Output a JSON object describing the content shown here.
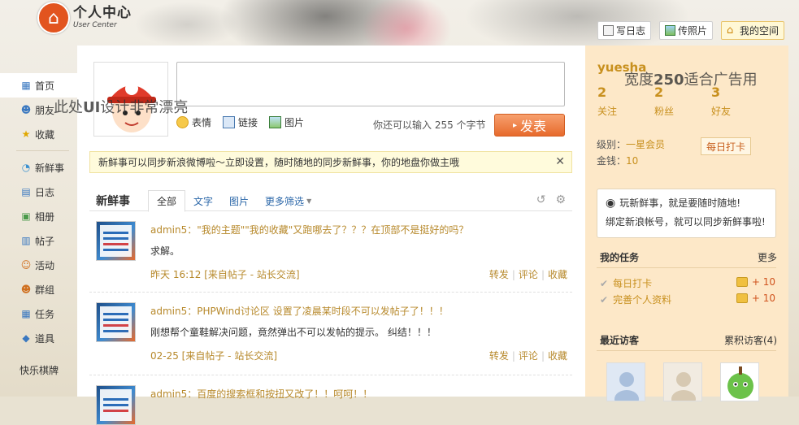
{
  "logo": {
    "title": "个人中心",
    "subtitle": "User Center"
  },
  "topbar": {
    "write_log": "写日志",
    "upload_photo": "传照片",
    "my_space": "我的空间"
  },
  "sidebar": {
    "items": [
      {
        "label": "首页",
        "icon": "home-icon"
      },
      {
        "label": "朋友",
        "icon": "friends-icon"
      },
      {
        "label": "收藏",
        "icon": "star-icon"
      },
      {
        "label": "新鲜事",
        "icon": "chat-icon"
      },
      {
        "label": "日志",
        "icon": "log-icon"
      },
      {
        "label": "相册",
        "icon": "album-icon"
      },
      {
        "label": "帖子",
        "icon": "post-icon"
      },
      {
        "label": "活动",
        "icon": "event-icon"
      },
      {
        "label": "群组",
        "icon": "group-icon"
      },
      {
        "label": "任务",
        "icon": "task-icon"
      },
      {
        "label": "道具",
        "icon": "tool-icon"
      }
    ],
    "game": "快乐棋牌"
  },
  "compose": {
    "emoji": "表情",
    "link": "链接",
    "image": "图片",
    "counter": "你还可以输入 255 个字节",
    "submit": "发表"
  },
  "notice": "新鲜事可以同步新浪微博啦～立即设置，随时随地的同步新鲜事，你的地盘你做主哦",
  "feed": {
    "title": "新鲜事",
    "tabs": [
      "全部",
      "文字",
      "图片",
      "更多筛选"
    ],
    "posts": [
      {
        "title": "admin5：\"我的主题\"\"我的收藏\"又跑哪去了？？？在顶部不是挺好的吗？",
        "body": "求解。",
        "meta": "昨天 16:12 [来自帖子 - 站长交流]"
      },
      {
        "title": "admin5：PHPWind讨论区 设置了凌晨某时段不可以发帖子了！！！",
        "body": "刚想帮个童鞋解决问题，竟然弹出不可以发帖的提示。 纠结！！！",
        "meta": "02-25 [来自帖子 - 站长交流]"
      },
      {
        "title": "admin5：百度的搜索框和按扭又改了！！呵呵！！",
        "body": "",
        "meta": ""
      }
    ],
    "actions": {
      "share": "转发",
      "comment": "评论",
      "fav": "收藏"
    }
  },
  "profile": {
    "username": "yuesha",
    "stats": [
      {
        "num": "2",
        "label": "关注"
      },
      {
        "num": "2",
        "label": "粉丝"
      },
      {
        "num": "3",
        "label": "好友"
      }
    ],
    "level_label": "级别：",
    "level": "一星会员",
    "money_label": "金钱：",
    "money": "10",
    "checkin": "每日打卡"
  },
  "sina": {
    "title": "玩新鲜事，就是要随时随地!",
    "desc": "绑定新浪帐号，就可以同步新鲜事啦!"
  },
  "tasks": {
    "title": "我的任务",
    "more": "更多",
    "items": [
      {
        "label": "每日打卡",
        "reward": "+ 10"
      },
      {
        "label": "完善个人资料",
        "reward": "+ 10"
      }
    ]
  },
  "visitors": {
    "title": "最近访客",
    "count": "累积访客(4)"
  },
  "watermarks": {
    "left_a": "此处",
    "left_b": "UI",
    "left_c": "设计非常漂亮",
    "right_a": "宽度",
    "right_b": "250",
    "right_c": "适合广告用"
  },
  "colors": {
    "accent": "#c8901e",
    "button": "#e76a2c",
    "panel": "#fde8c8"
  }
}
